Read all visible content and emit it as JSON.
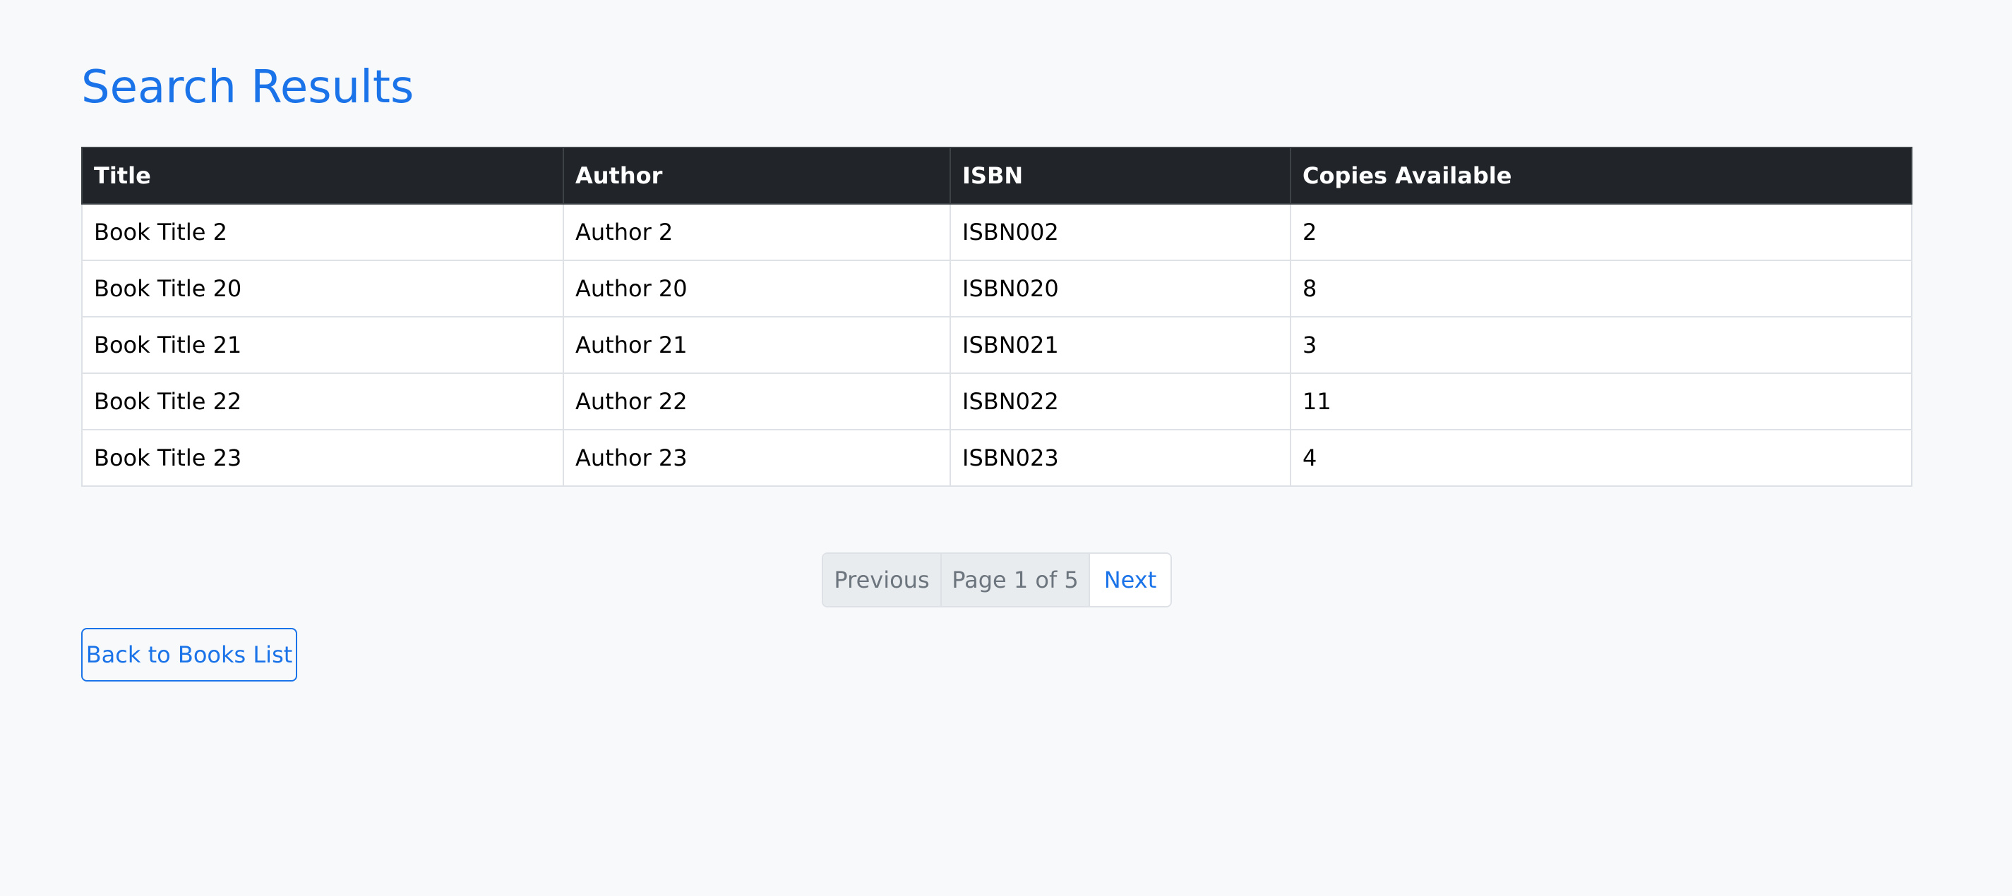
{
  "page": {
    "title": "Search Results"
  },
  "table": {
    "headers": [
      "Title",
      "Author",
      "ISBN",
      "Copies Available"
    ],
    "rows": [
      [
        "Book Title 2",
        "Author 2",
        "ISBN002",
        "2"
      ],
      [
        "Book Title 20",
        "Author 20",
        "ISBN020",
        "8"
      ],
      [
        "Book Title 21",
        "Author 21",
        "ISBN021",
        "3"
      ],
      [
        "Book Title 22",
        "Author 22",
        "ISBN022",
        "11"
      ],
      [
        "Book Title 23",
        "Author 23",
        "ISBN023",
        "4"
      ]
    ]
  },
  "pagination": {
    "previous_label": "Previous",
    "current_label": "Page 1 of 5",
    "next_label": "Next"
  },
  "actions": {
    "back_label": "Back to Books List"
  },
  "colors": {
    "accent": "#1a73e8",
    "header_bg": "#212529",
    "page_bg": "#f8f9fa"
  }
}
